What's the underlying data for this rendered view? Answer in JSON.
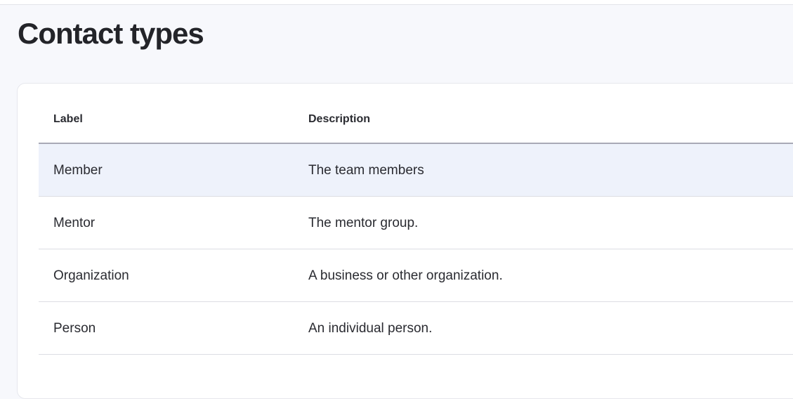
{
  "page": {
    "title": "Contact types"
  },
  "table": {
    "headers": {
      "label": "Label",
      "description": "Description"
    },
    "rows": [
      {
        "label": "Member",
        "description": "The team members"
      },
      {
        "label": "Mentor",
        "description": "The mentor group."
      },
      {
        "label": "Organization",
        "description": "A business or other organization."
      },
      {
        "label": "Person",
        "description": "An individual person."
      }
    ]
  },
  "colors": {
    "background": "#f7f8fc",
    "card": "#ffffff",
    "row_hover": "#eef2fb",
    "text": "#232429",
    "header_rule": "#a9aab6",
    "row_rule": "#dcdde3"
  }
}
